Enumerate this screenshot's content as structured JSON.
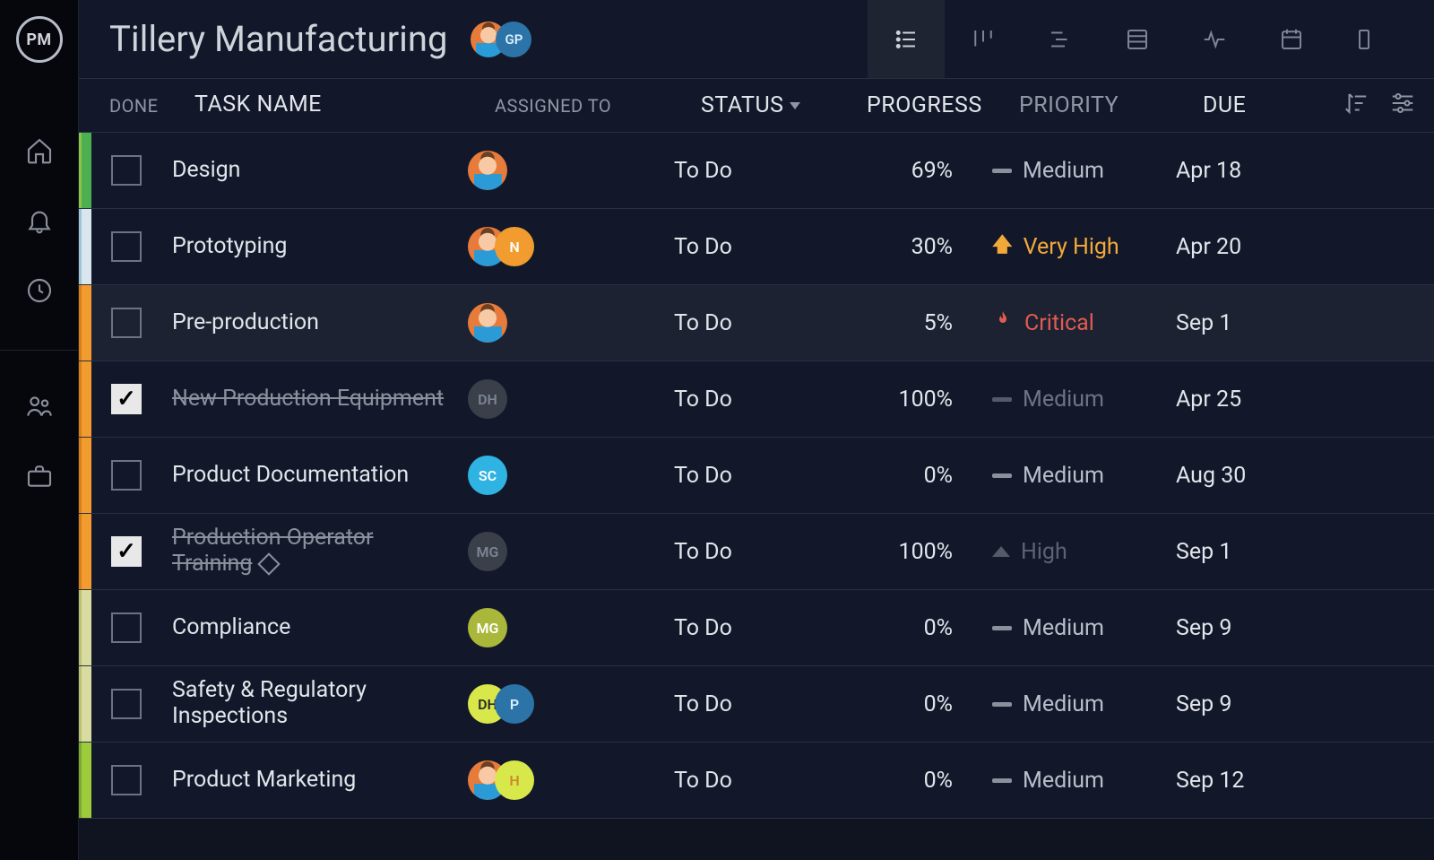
{
  "app": {
    "logoText": "PM"
  },
  "header": {
    "title": "Tillery Manufacturing",
    "avatars": [
      {
        "type": "face"
      },
      {
        "type": "initials",
        "text": "GP",
        "bg": "#2c74a8",
        "fg": "#d9f0ff"
      }
    ]
  },
  "columns": {
    "done": "DONE",
    "name": "TASK NAME",
    "assigned": "ASSIGNED TO",
    "status": "STATUS",
    "progress": "PROGRESS",
    "priority": "PRIORITY",
    "due": "DUE"
  },
  "tasks": [
    {
      "stripe": "green",
      "done": false,
      "name": "Design",
      "assignees": [
        {
          "type": "face"
        }
      ],
      "status": "To Do",
      "progress": "69%",
      "priority": {
        "level": "medium",
        "label": "Medium"
      },
      "due": "Apr 18",
      "selected": false,
      "milestone": false
    },
    {
      "stripe": "blue",
      "done": false,
      "name": "Prototyping",
      "assignees": [
        {
          "type": "face"
        },
        {
          "type": "initials",
          "text": "N",
          "bg": "#f29b2e",
          "fg": "#fff"
        }
      ],
      "status": "To Do",
      "progress": "30%",
      "priority": {
        "level": "veryhigh",
        "label": "Very High"
      },
      "due": "Apr 20",
      "selected": false,
      "milestone": false
    },
    {
      "stripe": "orange",
      "done": false,
      "name": "Pre-production",
      "assignees": [
        {
          "type": "face"
        }
      ],
      "status": "To Do",
      "progress": "5%",
      "priority": {
        "level": "critical",
        "label": "Critical"
      },
      "due": "Sep 1",
      "selected": true,
      "milestone": false
    },
    {
      "stripe": "orange",
      "done": true,
      "name": "New Production Equipment",
      "assignees": [
        {
          "type": "initials",
          "text": "DH",
          "bg": "#3a3f49",
          "fg": "#7d8494"
        }
      ],
      "status": "To Do",
      "progress": "100%",
      "priority": {
        "level": "medium",
        "label": "Medium",
        "dim": true
      },
      "due": "Apr 25",
      "selected": false,
      "milestone": false
    },
    {
      "stripe": "orange",
      "done": false,
      "name": "Product Documentation",
      "assignees": [
        {
          "type": "initials",
          "text": "SC",
          "bg": "#2fb3e3",
          "fg": "#fff"
        }
      ],
      "status": "To Do",
      "progress": "0%",
      "priority": {
        "level": "medium",
        "label": "Medium"
      },
      "due": "Aug 30",
      "selected": false,
      "milestone": false
    },
    {
      "stripe": "orange",
      "done": true,
      "name": "Production Operator Training",
      "assignees": [
        {
          "type": "initials",
          "text": "MG",
          "bg": "#3a3f49",
          "fg": "#7d8494"
        }
      ],
      "status": "To Do",
      "progress": "100%",
      "priority": {
        "level": "high",
        "label": "High",
        "dim": true
      },
      "due": "Sep 1",
      "selected": false,
      "milestone": true
    },
    {
      "stripe": "olive",
      "done": false,
      "name": "Compliance",
      "assignees": [
        {
          "type": "initials",
          "text": "MG",
          "bg": "#a9b83a",
          "fg": "#fff"
        }
      ],
      "status": "To Do",
      "progress": "0%",
      "priority": {
        "level": "medium",
        "label": "Medium"
      },
      "due": "Sep 9",
      "selected": false,
      "milestone": false
    },
    {
      "stripe": "olive",
      "done": false,
      "name": "Safety & Regulatory Inspections",
      "assignees": [
        {
          "type": "initials",
          "text": "DH",
          "bg": "#d8e84a",
          "fg": "#2a2a2a"
        },
        {
          "type": "initials",
          "text": "P",
          "bg": "#2c74a8",
          "fg": "#d9f0ff"
        }
      ],
      "status": "To Do",
      "progress": "0%",
      "priority": {
        "level": "medium",
        "label": "Medium"
      },
      "due": "Sep 9",
      "selected": false,
      "milestone": false
    },
    {
      "stripe": "lime",
      "done": false,
      "name": "Product Marketing",
      "assignees": [
        {
          "type": "face"
        },
        {
          "type": "initials",
          "text": "H",
          "bg": "#d8e84a",
          "fg": "#c98b2a"
        }
      ],
      "status": "To Do",
      "progress": "0%",
      "priority": {
        "level": "medium",
        "label": "Medium"
      },
      "due": "Sep 12",
      "selected": false,
      "milestone": false
    }
  ]
}
